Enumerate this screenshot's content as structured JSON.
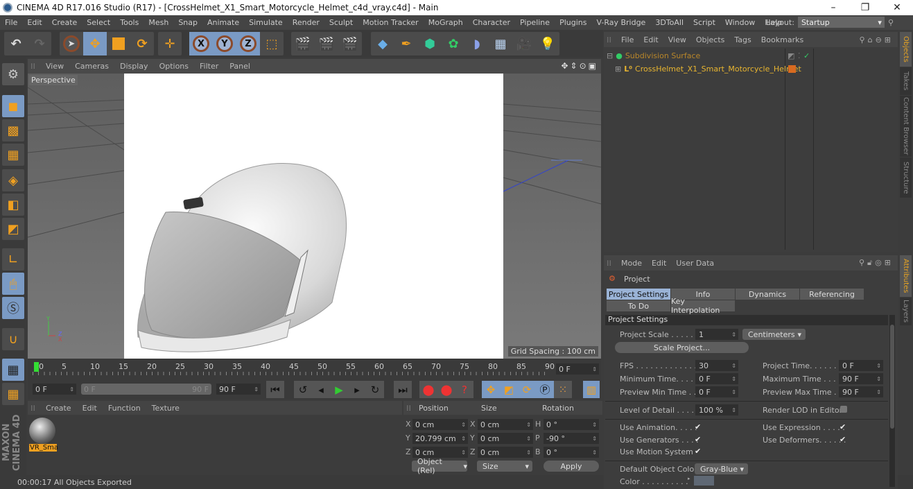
{
  "window": {
    "title": "CINEMA 4D R17.016 Studio (R17) - [CrossHelmet_X1_Smart_Motorcycle_Helmet_c4d_vray.c4d] - Main",
    "minimize": "–",
    "restore": "❐",
    "close": "✕"
  },
  "menubar": {
    "items": [
      "File",
      "Edit",
      "Create",
      "Select",
      "Tools",
      "Mesh",
      "Snap",
      "Animate",
      "Simulate",
      "Render",
      "Sculpt",
      "Motion Tracker",
      "MoGraph",
      "Character",
      "Pipeline",
      "Plugins",
      "V-Ray Bridge",
      "3DToAll",
      "Script",
      "Window",
      "Help"
    ],
    "layout_label": "Layout:",
    "layout_value": "Startup"
  },
  "toolbar": {
    "undo": "↶",
    "redo": "↷",
    "x": "X",
    "y": "Y",
    "z": "Z"
  },
  "viewport": {
    "menu": [
      "View",
      "Cameras",
      "Display",
      "Options",
      "Filter",
      "Panel"
    ],
    "camera": "Perspective",
    "grid_spacing": "Grid Spacing : 100 cm"
  },
  "timeline": {
    "ticks": [
      "0",
      "5",
      "10",
      "15",
      "20",
      "25",
      "30",
      "35",
      "40",
      "45",
      "50",
      "55",
      "60",
      "65",
      "70",
      "75",
      "80",
      "85",
      "90"
    ],
    "current_frame": "0 F",
    "start": "0 F",
    "range_start": "0 F",
    "range_end": "90 F",
    "end": "90 F"
  },
  "materials": {
    "menu": [
      "Create",
      "Edit",
      "Function",
      "Texture"
    ],
    "items": [
      {
        "name": "VR_Sma"
      }
    ]
  },
  "coordinates": {
    "headers": {
      "position": "Position",
      "size": "Size",
      "rotation": "Rotation"
    },
    "rows": [
      {
        "pl": "X",
        "pv": "0 cm",
        "sl": "X",
        "sv": "0 cm",
        "rl": "H",
        "rv": "0 °"
      },
      {
        "pl": "Y",
        "pv": "20.799 cm",
        "sl": "Y",
        "sv": "0 cm",
        "rl": "P",
        "rv": "-90 °"
      },
      {
        "pl": "Z",
        "pv": "0 cm",
        "sl": "Z",
        "sv": "0 cm",
        "rl": "B",
        "rv": "0 °"
      }
    ],
    "mode": "Object (Rel)",
    "size_mode": "Size",
    "apply": "Apply"
  },
  "object_manager": {
    "menu": [
      "File",
      "Edit",
      "View",
      "Objects",
      "Tags",
      "Bookmarks"
    ],
    "objects": [
      {
        "name": "Subdivision Surface",
        "color": "#b8862a"
      },
      {
        "name": "CrossHelmet_X1_Smart_Motorcycle_Helmet",
        "color": "#e8b530"
      }
    ]
  },
  "attributes": {
    "menu": [
      "Mode",
      "Edit",
      "User Data"
    ],
    "object": "Project",
    "tabs": [
      {
        "label": "Project Settings",
        "active": true
      },
      {
        "label": "Info"
      },
      {
        "label": "Dynamics"
      },
      {
        "label": "Referencing"
      },
      {
        "label": "To Do"
      },
      {
        "label": "Key Interpolation"
      }
    ],
    "section": "Project Settings",
    "project_scale_label": "Project Scale . . . . . .",
    "project_scale": "1",
    "unit": "Centimeters",
    "scale_project": "Scale Project...",
    "fps_label": "FPS . . . . . . . . . . . . . .",
    "fps": "30",
    "project_time_label": "Project Time. . . . . . . .",
    "project_time": "0 F",
    "min_time_label": "Minimum Time. . . . .",
    "min_time": "0 F",
    "max_time_label": "Maximum Time . . . . .",
    "max_time": "90 F",
    "prev_min_label": "Preview Min Time . .",
    "prev_min": "0 F",
    "prev_max_label": "Preview Max Time . . .",
    "prev_max": "90 F",
    "lod_label": "Level of Detail . . . . .",
    "lod": "100 %",
    "render_lod_label": "Render LOD in Editor",
    "use_animation": "Use Animation. . . . .",
    "use_expression": "Use Expression . . . . .",
    "use_generators": "Use Generators . . . .",
    "use_deformers": "Use Deformers. . . . . .",
    "use_motion": "Use Motion System",
    "default_color_label": "Default Object Color",
    "default_color": "Gray-Blue",
    "color_label": "Color . . . . . . . . . .",
    "check": "✔"
  },
  "side_tabs": {
    "top": [
      "Objects",
      "Takes",
      "Content Browser",
      "Structure"
    ],
    "bottom": [
      "Attributes",
      "Layers"
    ]
  },
  "status": "00:00:17 All Objects Exported",
  "brand": "MAXON CINEMA 4D"
}
